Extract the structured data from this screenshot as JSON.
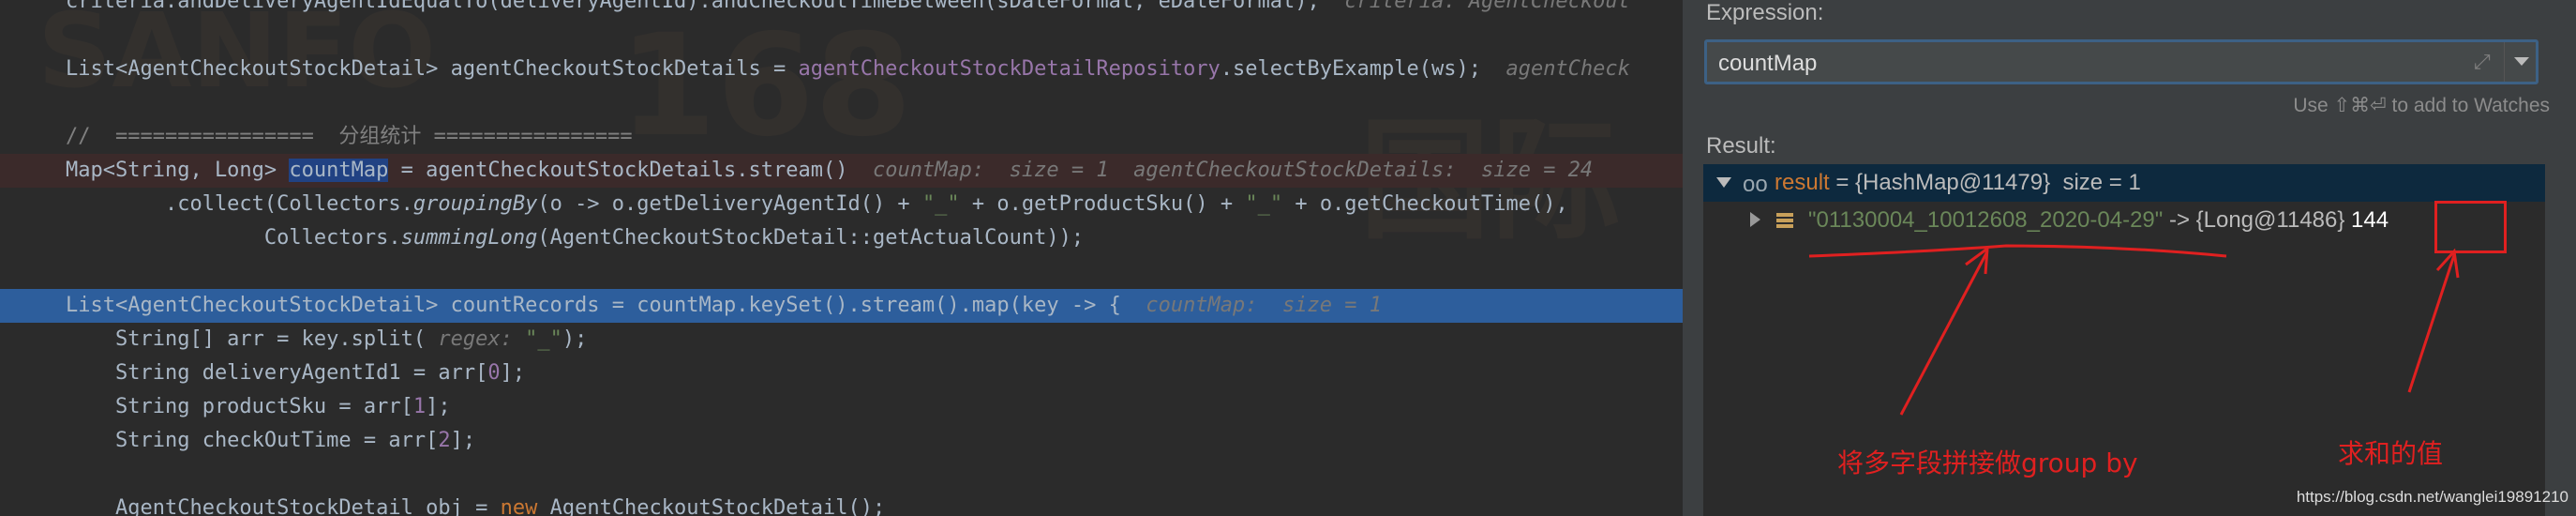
{
  "editor": {
    "watermarks": [
      "SANFO",
      "168",
      "国际"
    ],
    "lines": [
      {
        "segments": [
          {
            "t": "criteria.andDeliveryAgentIdEqualTo(deliveryAgentId).andCheckoutTimeBetween(sDateFormat, eDateFormat);  "
          },
          {
            "t": "criteria: AgentCheckout",
            "c": "hint"
          }
        ]
      },
      {
        "segments": []
      },
      {
        "segments": [
          {
            "t": "List<AgentCheckoutStockDetail> agentCheckoutStockDetails = "
          },
          {
            "t": "agentCheckoutStockDetailRepository",
            "c": "fld"
          },
          {
            "t": ".selectByExample(ws);  "
          },
          {
            "t": "agentCheck",
            "c": "hint"
          }
        ]
      },
      {
        "segments": []
      },
      {
        "segments": [
          {
            "t": "//  ================  分组统计 ================",
            "c": "cmt"
          }
        ]
      },
      {
        "segments": [
          {
            "t": "Map<String, Long> "
          },
          {
            "t": "countMap",
            "c": "hl"
          },
          {
            "t": " = agentCheckoutStockDetails.stream()  "
          },
          {
            "t": "countMap:  size = 1  agentCheckoutStockDetails:  size = 24",
            "c": "hint"
          }
        ]
      },
      {
        "segments": [
          {
            "t": "        .collect(Collectors."
          },
          {
            "t": "groupingBy",
            "c": "ital"
          },
          {
            "t": "(o -> o.getDeliveryAgentId() + "
          },
          {
            "t": "\"_\"",
            "c": "str"
          },
          {
            "t": " + o.getProductSku() + "
          },
          {
            "t": "\"_\"",
            "c": "str"
          },
          {
            "t": " + o.getCheckoutTime(),"
          }
        ]
      },
      {
        "segments": [
          {
            "t": "                Collectors."
          },
          {
            "t": "summingLong",
            "c": "ital"
          },
          {
            "t": "(AgentCheckoutStockDetail::getActualCount));"
          }
        ]
      },
      {
        "segments": []
      },
      {
        "segments": [
          {
            "t": "List<AgentCheckoutStockDetail> countRecords = countMap.keySet().stream().map(key -> {  "
          },
          {
            "t": "countMap:  size = 1",
            "c": "hint"
          }
        ]
      },
      {
        "segments": [
          {
            "t": "    String[] arr = key.split( "
          },
          {
            "t": "regex: ",
            "c": "hint"
          },
          {
            "t": "\"_\"",
            "c": "str"
          },
          {
            "t": ");"
          }
        ]
      },
      {
        "segments": [
          {
            "t": "    String deliveryAgentId1 = arr["
          },
          {
            "t": "0",
            "c": "fld"
          },
          {
            "t": "];"
          }
        ]
      },
      {
        "segments": [
          {
            "t": "    String productSku = arr["
          },
          {
            "t": "1",
            "c": "fld"
          },
          {
            "t": "];"
          }
        ]
      },
      {
        "segments": [
          {
            "t": "    String checkOutTime = arr["
          },
          {
            "t": "2",
            "c": "fld"
          },
          {
            "t": "];"
          }
        ]
      },
      {
        "segments": []
      },
      {
        "segments": [
          {
            "t": "    AgentCheckoutStockDetail obj = "
          },
          {
            "t": "new",
            "c": "kw"
          },
          {
            "t": " AgentCheckoutStockDetail();"
          }
        ]
      }
    ]
  },
  "evaluate": {
    "expression_label": "Expression:",
    "expression_value": "countMap",
    "watch_hint": "Use ⇧⌘⏎ to add to Watches",
    "result_label": "Result:",
    "root": {
      "name": "result",
      "value": " = {HashMap@11479}  size = 1"
    },
    "entry": {
      "key": "\"01130004_10012608_2020-04-29\"",
      "ref": " -> {Long@11486} ",
      "value": "144"
    }
  },
  "annotations": {
    "group_by_note": "将多字段拼接做group by",
    "sum_note": "求和的值",
    "credit": "https://blog.csdn.net/wanglei19891210"
  },
  "colors": {
    "annotation": "#e02020",
    "selection": "#2d5e9c",
    "keyword": "#cc7832",
    "string": "#6a8759"
  }
}
